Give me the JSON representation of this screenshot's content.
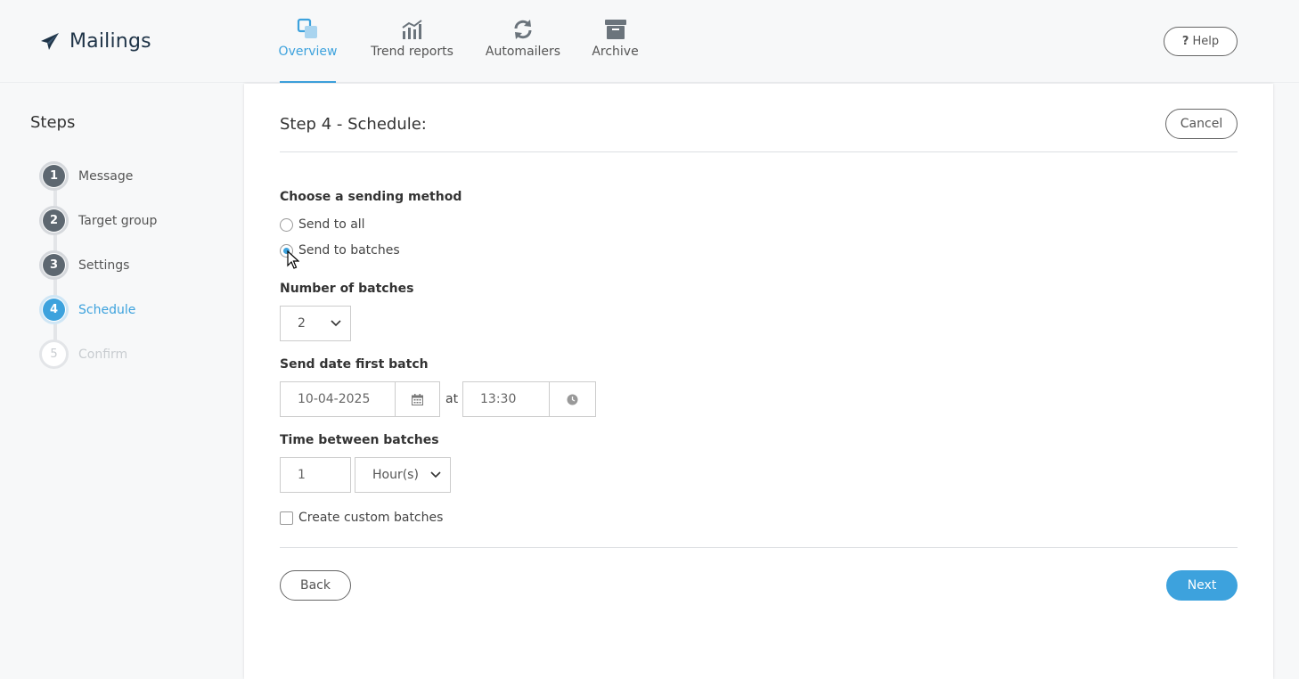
{
  "app": {
    "title": "Mailings",
    "help_label": "Help",
    "help_icon": "?"
  },
  "nav": {
    "tabs": [
      {
        "label": "Overview",
        "icon": "overview-icon",
        "active": true
      },
      {
        "label": "Trend reports",
        "icon": "bar-chart-icon",
        "active": false
      },
      {
        "label": "Automailers",
        "icon": "refresh-icon",
        "active": false
      },
      {
        "label": "Archive",
        "icon": "archive-box-icon",
        "active": false
      }
    ]
  },
  "sidebar": {
    "title": "Steps",
    "steps": [
      {
        "number": "1",
        "label": "Message",
        "state": "done"
      },
      {
        "number": "2",
        "label": "Target group",
        "state": "done"
      },
      {
        "number": "3",
        "label": "Settings",
        "state": "done"
      },
      {
        "number": "4",
        "label": "Schedule",
        "state": "current"
      },
      {
        "number": "5",
        "label": "Confirm",
        "state": "future"
      }
    ]
  },
  "main": {
    "title": "Step 4 - Schedule:",
    "cancel_label": "Cancel",
    "sending_method": {
      "label": "Choose a sending method",
      "options": [
        {
          "label": "Send to all",
          "checked": false
        },
        {
          "label": "Send to batches",
          "checked": true
        }
      ]
    },
    "num_batches": {
      "label": "Number of batches",
      "value": "2"
    },
    "send_date": {
      "label": "Send date first batch",
      "date": "10-04-2025",
      "at": "at",
      "time": "13:30"
    },
    "time_between": {
      "label": "Time between batches",
      "value": "1",
      "unit": "Hour(s)"
    },
    "custom_batches": {
      "label": "Create custom batches",
      "checked": false
    },
    "back_label": "Back",
    "next_label": "Next"
  },
  "colors": {
    "accent": "#3da2dd",
    "brand_dark": "#1e3347",
    "step_done": "#5d6770"
  }
}
